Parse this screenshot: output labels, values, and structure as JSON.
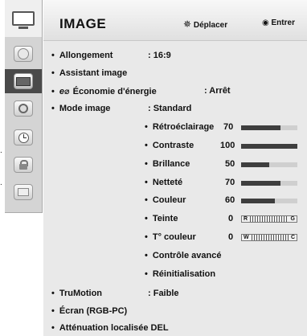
{
  "header": {
    "title": "IMAGE",
    "move_hint": "Déplacer",
    "enter_hint": "Entrer"
  },
  "side_cut": [
    ".",
    "."
  ],
  "sidebar": {
    "items": [
      {
        "icon": "tv-icon"
      },
      {
        "icon": "globe-icon"
      },
      {
        "icon": "picture-icon"
      },
      {
        "icon": "speaker-icon"
      },
      {
        "icon": "clock-icon"
      },
      {
        "icon": "lock-icon"
      },
      {
        "icon": "options-icon"
      }
    ]
  },
  "menu": {
    "items": [
      {
        "label": "Allongement",
        "value": ": 16:9"
      },
      {
        "label": "Assistant image"
      },
      {
        "prefix": "e⌀",
        "label": "Économie d'énergie",
        "value": ": Arrêt"
      },
      {
        "label": "Mode image",
        "value": ": Standard"
      }
    ],
    "settings": [
      {
        "label": "Rétroéclairage",
        "value": "70",
        "level": 70
      },
      {
        "label": "Contraste",
        "value": "100",
        "level": 100
      },
      {
        "label": "Brillance",
        "value": "50",
        "level": 50
      },
      {
        "label": "Netteté",
        "value": "70",
        "level": 70
      },
      {
        "label": "Couleur",
        "value": "60",
        "level": 60
      },
      {
        "label": "Teinte",
        "value": "0",
        "left": "R",
        "right": "G"
      },
      {
        "label": "T° couleur",
        "value": "0",
        "left": "W",
        "right": "C"
      },
      {
        "label": "Contrôle avancé"
      },
      {
        "label": "Réinitialisation"
      }
    ],
    "bottom": [
      {
        "label": "TruMotion",
        "value": ": Faible"
      },
      {
        "label": "Écran (RGB-PC)"
      },
      {
        "label": "Atténuation localisée DEL"
      }
    ]
  }
}
